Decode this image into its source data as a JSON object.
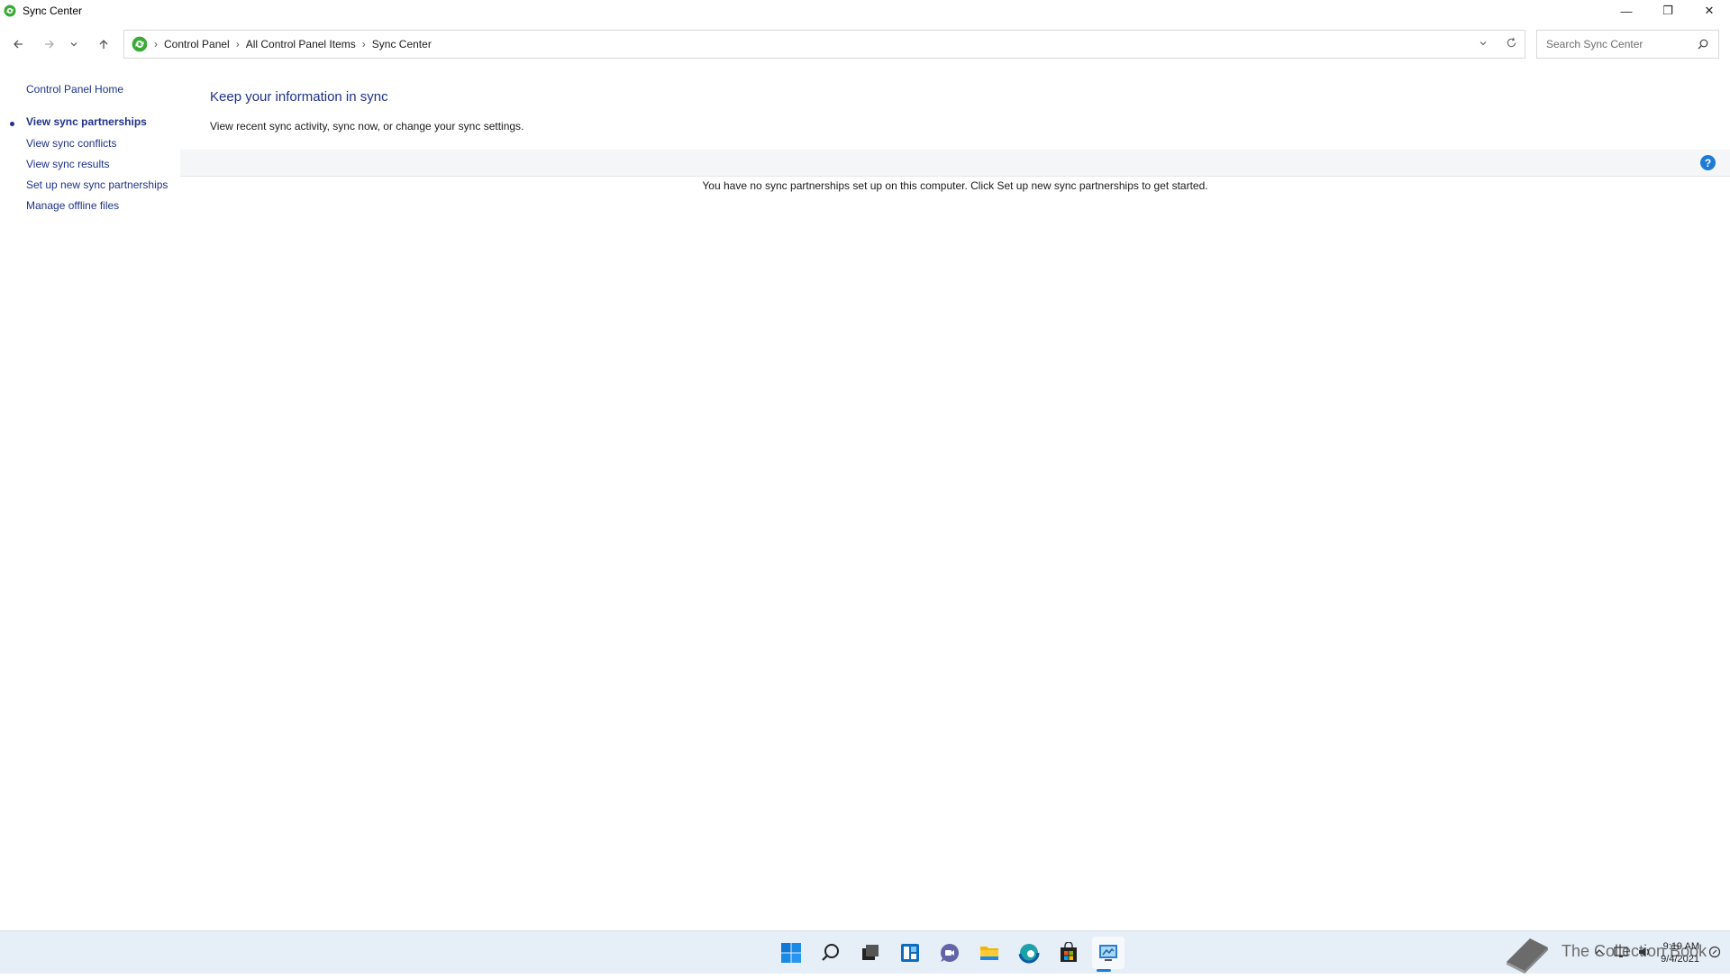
{
  "window": {
    "title": "Sync Center",
    "controls": {
      "minimize": "—",
      "restore": "❐",
      "close": "✕"
    }
  },
  "addressbar": {
    "crumbs": [
      "Control Panel",
      "All Control Panel Items",
      "Sync Center"
    ],
    "search_placeholder": "Search Sync Center"
  },
  "leftnav": {
    "home": "Control Panel Home",
    "items": [
      {
        "label": "View sync partnerships",
        "active": true
      },
      {
        "label": "View sync conflicts",
        "active": false
      },
      {
        "label": "View sync results",
        "active": false
      },
      {
        "label": "Set up new sync partnerships",
        "active": false
      },
      {
        "label": "Manage offline files",
        "active": false
      }
    ]
  },
  "main": {
    "title": "Keep your information in sync",
    "subtitle": "View recent sync activity, sync now, or change your sync settings.",
    "empty_message": "You have no sync partnerships set up on this computer. Click Set up new sync partnerships to get started.",
    "help_label": "?"
  },
  "taskbar": {
    "icons": [
      "windows-start-icon",
      "search-icon",
      "task-view-icon",
      "widgets-icon",
      "chat-icon",
      "file-explorer-icon",
      "edge-icon",
      "store-icon",
      "control-panel-icon"
    ],
    "watermark": "The Collection Book",
    "time": "9:19 AM",
    "date": "9/4/2021"
  },
  "colors": {
    "accent": "#1e3287",
    "link": "#1e3287",
    "taskbar": "#e6eef7",
    "help": "#1e7bd6"
  }
}
